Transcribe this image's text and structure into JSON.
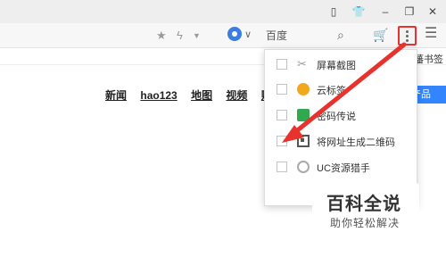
{
  "toolbar": {
    "engine_label": "百度"
  },
  "bookmark_bar": {
    "item": "藩书签"
  },
  "page": {
    "nav_links": [
      "新闻",
      "hao123",
      "地图",
      "视频",
      "贴"
    ],
    "product_button": "产品"
  },
  "dropdown": {
    "items": [
      {
        "label": "屏幕截图",
        "icon": "scissors-icon"
      },
      {
        "label": "云标签",
        "icon": "cloud-icon"
      },
      {
        "label": "密码传说",
        "icon": "lock-icon"
      },
      {
        "label": "将网址生成二维码",
        "icon": "qr-code-icon"
      },
      {
        "label": "UC资源猎手",
        "icon": "gauge-icon"
      }
    ]
  },
  "watermark": {
    "title": "百科全说",
    "subtitle": "助你轻松解决"
  },
  "colors": {
    "highlight": "#e8322d",
    "accent_blue": "#3385ff"
  }
}
